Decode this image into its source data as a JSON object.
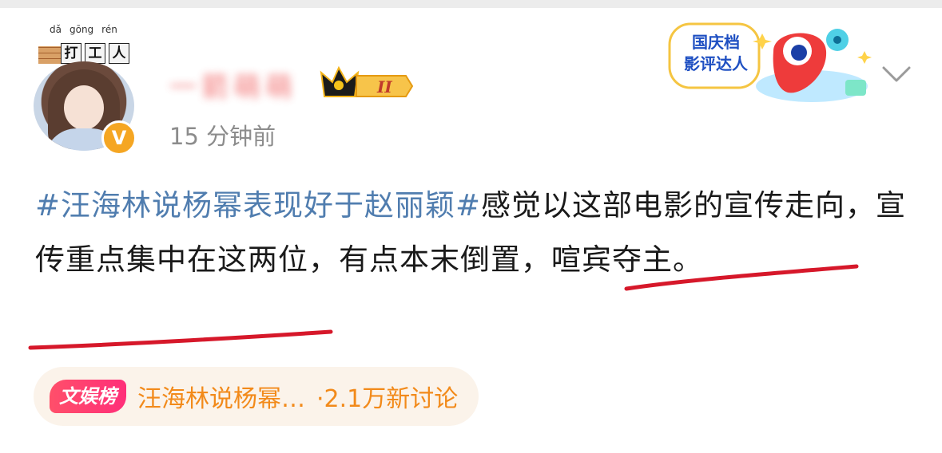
{
  "user": {
    "name": "一箭萌萌",
    "time": "15 分钟前",
    "title_pinyin": [
      "dǎ",
      "gōng",
      "rén"
    ],
    "title_chars": [
      "打",
      "工",
      "人"
    ],
    "vip_level": "II",
    "medal": {
      "line1": "国庆档",
      "line2": "影评达人"
    }
  },
  "post": {
    "hashtag": "#汪海林说杨幂表现好于赵丽颖#",
    "text_part1": "感觉以这部电影的宣传走向，宣传重点集中在这两位，",
    "text_part2": "有点本末倒置，喧宾夺主。"
  },
  "topic": {
    "badge": "文娱榜",
    "title": "汪海林说杨幂…",
    "count": "·2.1万新讨论"
  },
  "colors": {
    "hashtag": "#507daf",
    "underline": "#d6182a",
    "topic_text": "#f28a1a",
    "badge_pink": "#ff3b72"
  }
}
